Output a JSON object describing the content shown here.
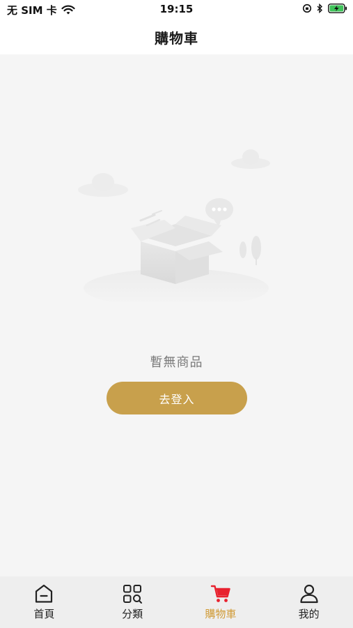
{
  "status_bar": {
    "carrier": "无 SIM 卡",
    "time": "19:15",
    "wifi_icon": "wifi-icon",
    "location_icon": "orientation-lock-icon",
    "bluetooth_icon": "bluetooth-icon",
    "battery_icon": "battery-charging-icon"
  },
  "header": {
    "title": "購物車"
  },
  "empty_state": {
    "illustration_icon": "empty-box-icon",
    "message": "暫無商品",
    "login_button_label": "去登入"
  },
  "tab_bar": {
    "items": [
      {
        "label": "首頁",
        "icon": "home-icon",
        "active": false
      },
      {
        "label": "分類",
        "icon": "category-search-icon",
        "active": false
      },
      {
        "label": "購物車",
        "icon": "cart-icon",
        "active": true
      },
      {
        "label": "我的",
        "icon": "user-icon",
        "active": false
      }
    ]
  },
  "colors": {
    "accent_gold": "#c8a04c",
    "active_tab_label": "#d09a35",
    "active_cart_icon": "#e8212e",
    "page_background": "#f5f5f5"
  }
}
